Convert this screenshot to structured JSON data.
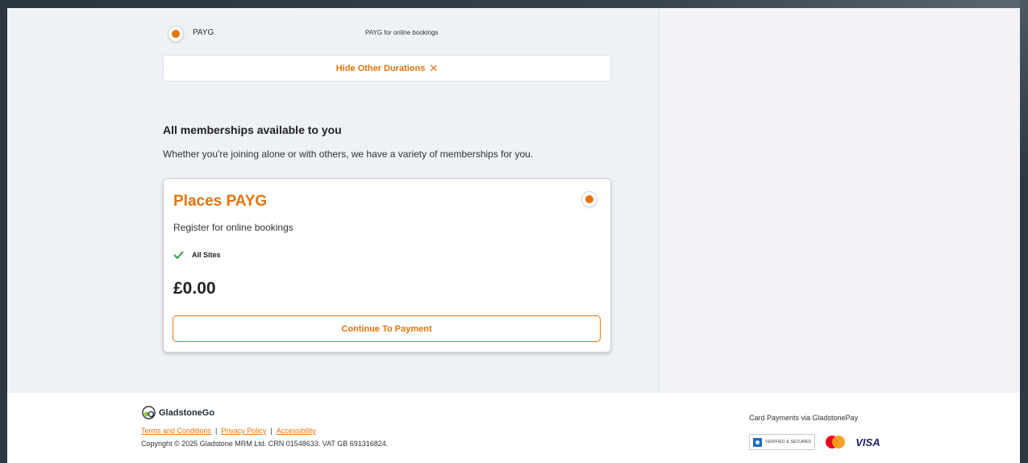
{
  "durations": {
    "option_label": "PAYG",
    "option_description": "PAYG for online bookings",
    "hide_button_label": "Hide Other Durations",
    "hide_button_icon": "✕"
  },
  "memberships": {
    "title": "All memberships available to you",
    "subtitle": "Whether you're joining alone or with others, we have a variety of memberships for you.",
    "card": {
      "title": "Places PAYG",
      "description": "Register for online bookings",
      "feature": "All Sites",
      "price": "£0.00",
      "cta_label": "Continue To Payment"
    }
  },
  "footer": {
    "brand": "GladstoneGo",
    "links": [
      "Terms and Conditions",
      "Privacy Policy",
      "Accessibility"
    ],
    "link_separator": "|",
    "copyright": "Copyright © 2025 Gladstone MRM Ltd. CRN 01548633. VAT GB 691316824.",
    "payments_label": "Card Payments via GladstonePay",
    "verified_badge_text": "VERIFIED & SECURED",
    "visa_text": "VISA"
  },
  "colors": {
    "accent": "#e8730c",
    "background": "#eef1f5",
    "card": "#ffffff",
    "check": "#2e9e3f"
  }
}
